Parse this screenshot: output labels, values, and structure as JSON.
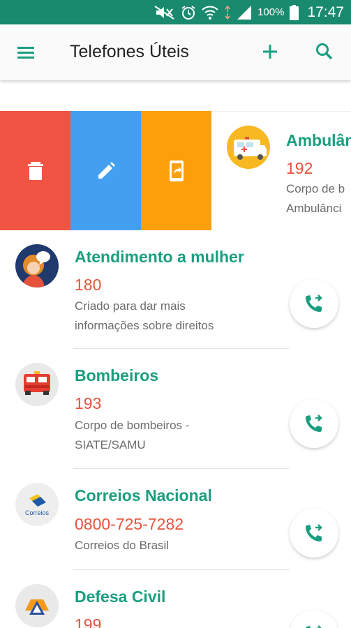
{
  "statusbar": {
    "battery_text": "100%",
    "time": "17:47",
    "icons": [
      "mute-icon",
      "alarm-icon",
      "wifi-icon",
      "signal-icon",
      "battery-icon"
    ]
  },
  "appbar": {
    "title": "Telefones Úteis",
    "icons": [
      "menu-icon",
      "add-icon",
      "search-icon"
    ]
  },
  "colors": {
    "primary": "#1a8a6e",
    "title_green": "#1a9e80",
    "phone_red": "#e5533d",
    "delete_red": "#f15442",
    "edit_blue": "#43a0f0",
    "share_orange": "#fb9f0a"
  },
  "swiped_row": {
    "title": "Ambulân",
    "phone": "192",
    "desc_line1": "Corpo de b",
    "desc_line2": "Ambulânci",
    "icon": "ambulance-icon",
    "actions": [
      "delete-icon",
      "edit-icon",
      "share-icon"
    ]
  },
  "rows": [
    {
      "title": "Atendimento a mulher",
      "phone": "180",
      "desc_line1": "Criado para dar mais",
      "desc_line2": "informações sobre direitos",
      "icon": "woman-icon"
    },
    {
      "title": "Bombeiros",
      "phone": "193",
      "desc_line1": "Corpo de bombeiros -",
      "desc_line2": "SIATE/SAMU",
      "icon": "firetruck-icon"
    },
    {
      "title": "Correios Nacional",
      "phone": "0800-725-7282",
      "desc_line1": "Correios do Brasil",
      "desc_line2": "",
      "icon": "correios-icon",
      "logo_text": "Correios"
    },
    {
      "title": "Defesa Civil",
      "phone": "199",
      "desc_line1": "",
      "desc_line2": "",
      "icon": "civil-defense-icon"
    }
  ]
}
